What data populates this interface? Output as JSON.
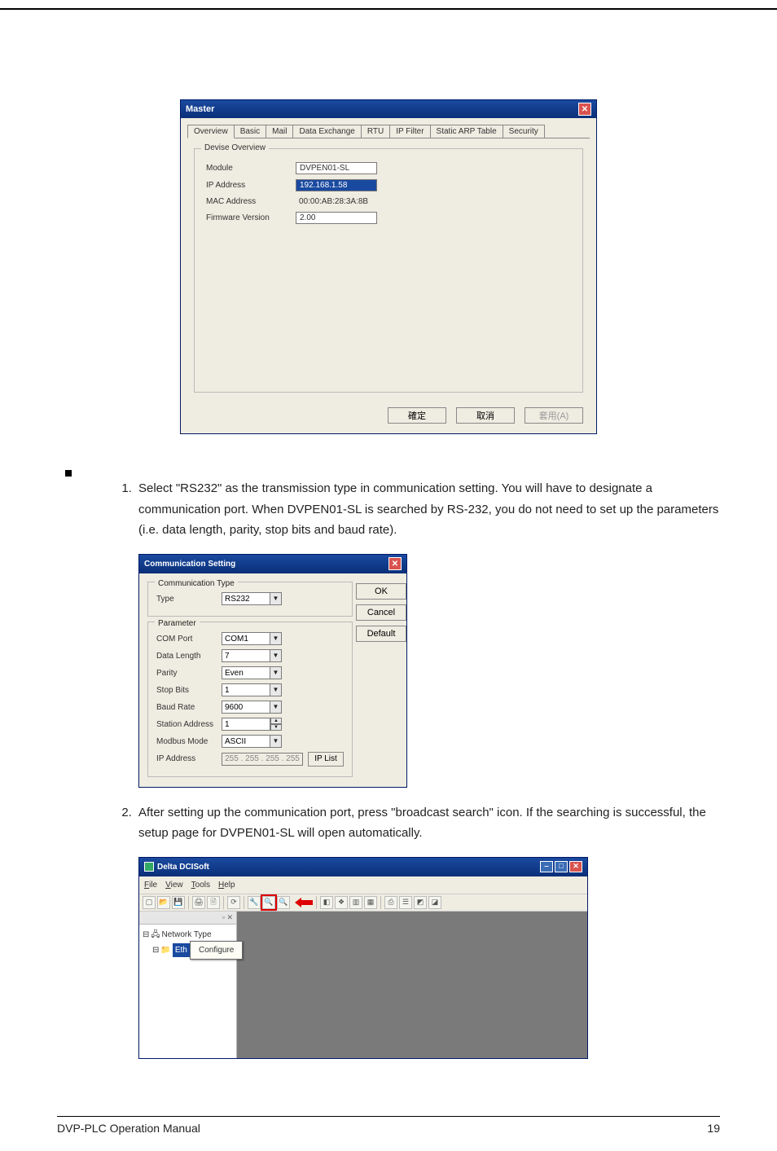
{
  "master": {
    "title": "Master",
    "tabs": [
      "Overview",
      "Basic",
      "Mail",
      "Data Exchange",
      "RTU",
      "IP Filter",
      "Static ARP Table",
      "Security"
    ],
    "fieldsetLegend": "Devise Overview",
    "rows": {
      "module": {
        "label": "Module",
        "value": "DVPEN01-SL"
      },
      "ip": {
        "label": "IP Address",
        "value": "192.168.1.58"
      },
      "mac": {
        "label": "MAC Address",
        "value": "00:00:AB:28:3A:8B"
      },
      "fw": {
        "label": "Firmware Version",
        "value": "2.00"
      }
    },
    "buttons": {
      "ok": "確定",
      "cancel": "取消",
      "apply": "套用(A)"
    }
  },
  "doc": {
    "step1": "Select \"RS232\" as the transmission type in communication setting. You will have to designate a communication port. When DVPEN01-SL is searched by RS-232, you do not need to set up the parameters (i.e. data length, parity, stop bits and baud rate).",
    "step2": "After setting up the communication port, press \"broadcast search\" icon. If the searching is successful, the setup page for DVPEN01-SL will open automatically."
  },
  "comm": {
    "title": "Communication Setting",
    "typeLegend": "Communication Type",
    "paramLegend": "Parameter",
    "fields": {
      "type": {
        "label": "Type",
        "value": "RS232"
      },
      "comport": {
        "label": "COM Port",
        "value": "COM1"
      },
      "datalen": {
        "label": "Data Length",
        "value": "7"
      },
      "parity": {
        "label": "Parity",
        "value": "Even"
      },
      "stopbits": {
        "label": "Stop Bits",
        "value": "1"
      },
      "baud": {
        "label": "Baud Rate",
        "value": "9600"
      },
      "station": {
        "label": "Station Address",
        "value": "1"
      },
      "modbus": {
        "label": "Modbus Mode",
        "value": "ASCII"
      },
      "ipaddr": {
        "label": "IP Address",
        "value": "255 . 255 . 255 . 255"
      }
    },
    "iplistBtn": "IP List",
    "buttons": {
      "ok": "OK",
      "cancel": "Cancel",
      "default": "Default"
    }
  },
  "dci": {
    "title": "Delta DCISoft",
    "menu": {
      "file": "File",
      "view": "View",
      "tools": "Tools",
      "help": "Help"
    },
    "tree": {
      "root": "Network Type",
      "child": "Eth",
      "contextMenu": "Configure"
    }
  },
  "footer": {
    "left": "DVP-PLC Operation Manual",
    "right": "19"
  }
}
